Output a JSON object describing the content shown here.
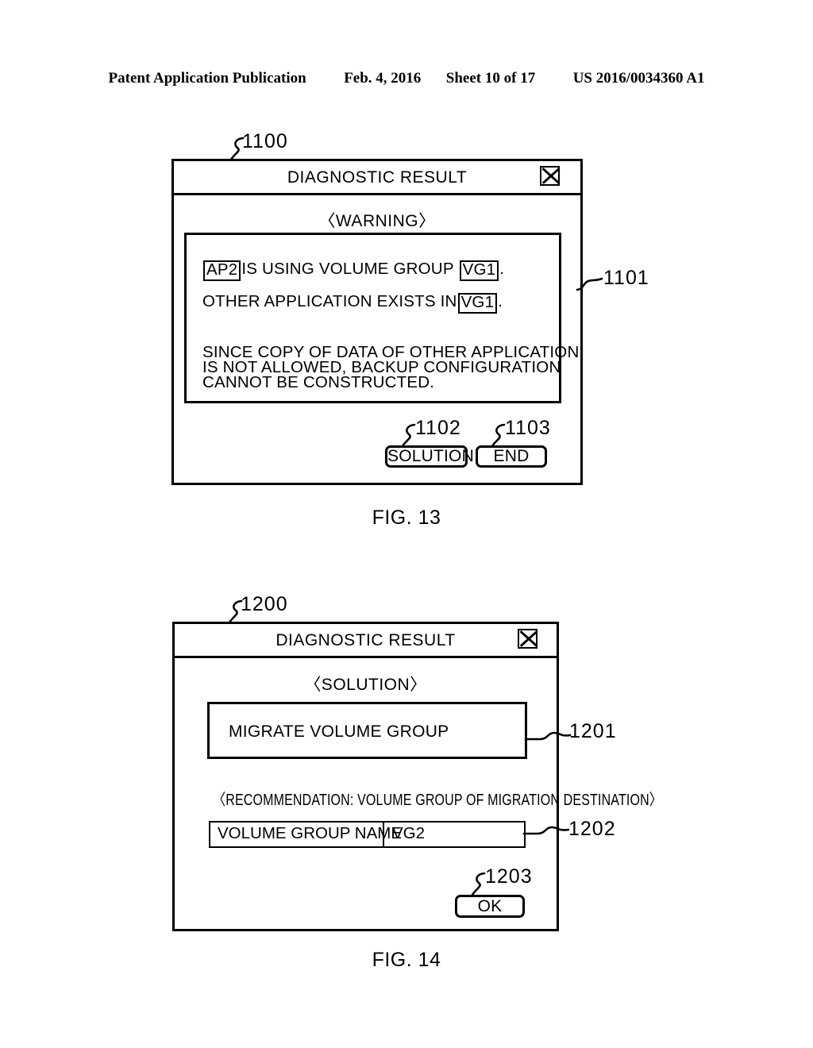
{
  "header": {
    "publication": "Patent Application Publication",
    "date": "Feb. 4, 2016",
    "sheet": "Sheet 10 of 17",
    "docnum": "US 2016/0034360 A1"
  },
  "fig13": {
    "caption": "FIG. 13",
    "ref_dialog": "1100",
    "titlebar": {
      "title": "DIAGNOSTIC RESULT",
      "close_icon": "close-icon"
    },
    "heading": "〈WARNING〉",
    "warning_box": {
      "ref": "1101",
      "line1": {
        "token1": "AP2",
        "mid": "IS USING VOLUME GROUP",
        "token2": "VG1",
        "end": "."
      },
      "line2": {
        "text": "OTHER APPLICATION EXISTS IN",
        "token": "VG1",
        "end": "."
      },
      "paragraph": [
        "SINCE COPY OF DATA OF OTHER APPLICATION",
        "IS NOT ALLOWED, BACKUP CONFIGURATION",
        "CANNOT BE CONSTRUCTED."
      ]
    },
    "buttons": [
      {
        "label": "SOLUTION",
        "ref": "1102"
      },
      {
        "label": "END",
        "ref": "1103"
      }
    ]
  },
  "fig14": {
    "caption": "FIG. 14",
    "ref_dialog": "1200",
    "titlebar": {
      "title": "DIAGNOSTIC RESULT",
      "close_icon": "close-icon"
    },
    "heading": "〈SOLUTION〉",
    "migrate_box": {
      "label": "MIGRATE VOLUME GROUP",
      "ref": "1201"
    },
    "recommendation": "〈RECOMMENDATION: VOLUME GROUP OF MIGRATION DESTINATION〉",
    "table": {
      "ref": "1202",
      "label": "VOLUME GROUP NAME",
      "value": "VG2"
    },
    "buttons": [
      {
        "label": "OK",
        "ref": "1203"
      }
    ]
  },
  "colors": {
    "ink": "#000000",
    "paper": "#ffffff"
  }
}
